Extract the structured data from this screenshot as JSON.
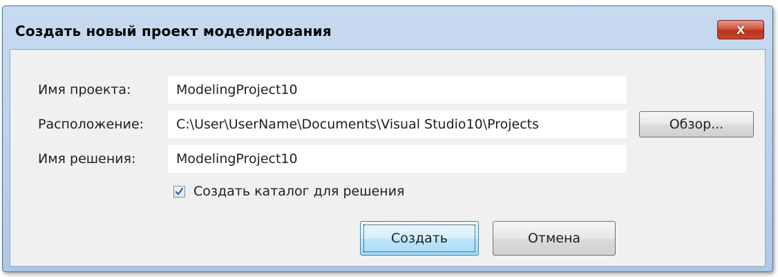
{
  "dialog": {
    "title": "Создать новый проект моделирования",
    "close_label": "X"
  },
  "form": {
    "project_name": {
      "label": "Имя проекта:",
      "value": "ModelingProject10"
    },
    "location": {
      "label": "Расположение:",
      "value": "C:\\User\\UserName\\Documents\\Visual Studio10\\Projects",
      "browse_label": "Обзор..."
    },
    "solution_name": {
      "label": "Имя решения:",
      "value": "ModelingProject10"
    },
    "create_directory": {
      "label": "Создать каталог для решения",
      "checked": true
    }
  },
  "buttons": {
    "create_label": "Создать",
    "cancel_label": "Отмена"
  },
  "icons": {
    "close": "close-icon",
    "checkbox_check": "checkmark-icon"
  },
  "colors": {
    "frame": "#bad0ea",
    "close_button": "#c9462d",
    "client_background": "#f0f0f0",
    "checkmark": "#2c5d9c"
  }
}
